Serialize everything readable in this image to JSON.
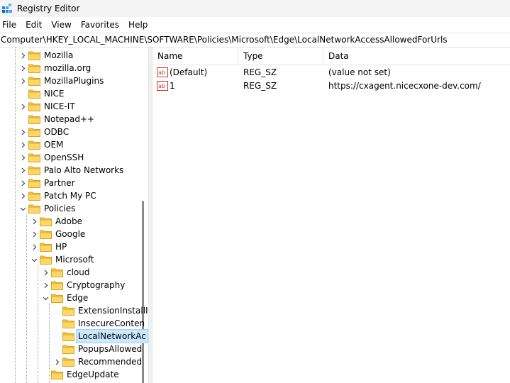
{
  "window": {
    "title": "Registry Editor"
  },
  "menu": [
    "File",
    "Edit",
    "View",
    "Favorites",
    "Help"
  ],
  "address": "Computer\\HKEY_LOCAL_MACHINE\\SOFTWARE\\Policies\\Microsoft\\Edge\\LocalNetworkAccessAllowedForUrls",
  "tree": [
    {
      "label": "Mozilla",
      "level": 0,
      "chevron": "right"
    },
    {
      "label": "mozilla.org",
      "level": 0,
      "chevron": "right"
    },
    {
      "label": "MozillaPlugins",
      "level": 0,
      "chevron": "right"
    },
    {
      "label": "NICE",
      "level": 0,
      "chevron": "none"
    },
    {
      "label": "NICE-IT",
      "level": 0,
      "chevron": "right"
    },
    {
      "label": "Notepad++",
      "level": 0,
      "chevron": "none"
    },
    {
      "label": "ODBC",
      "level": 0,
      "chevron": "right"
    },
    {
      "label": "OEM",
      "level": 0,
      "chevron": "right"
    },
    {
      "label": "OpenSSH",
      "level": 0,
      "chevron": "right"
    },
    {
      "label": "Palo Alto Networks",
      "level": 0,
      "chevron": "right"
    },
    {
      "label": "Partner",
      "level": 0,
      "chevron": "right"
    },
    {
      "label": "Patch My PC",
      "level": 0,
      "chevron": "right"
    },
    {
      "label": "Policies",
      "level": 0,
      "chevron": "down"
    },
    {
      "label": "Adobe",
      "level": 1,
      "chevron": "right"
    },
    {
      "label": "Google",
      "level": 1,
      "chevron": "right"
    },
    {
      "label": "HP",
      "level": 1,
      "chevron": "right"
    },
    {
      "label": "Microsoft",
      "level": 1,
      "chevron": "down"
    },
    {
      "label": "cloud",
      "level": 2,
      "chevron": "right"
    },
    {
      "label": "Cryptography",
      "level": 2,
      "chevron": "right"
    },
    {
      "label": "Edge",
      "level": 2,
      "chevron": "down"
    },
    {
      "label": "ExtensionInstallI",
      "level": 3,
      "chevron": "none"
    },
    {
      "label": "InsecureConten",
      "level": 3,
      "chevron": "none"
    },
    {
      "label": "LocalNetworkAc",
      "level": 3,
      "chevron": "none",
      "selected": true
    },
    {
      "label": "PopupsAllowed",
      "level": 3,
      "chevron": "none"
    },
    {
      "label": "Recommended",
      "level": 3,
      "chevron": "right"
    },
    {
      "label": "EdgeUpdate",
      "level": 2,
      "chevron": "none"
    }
  ],
  "columns": [
    "Name",
    "Type",
    "Data"
  ],
  "values": [
    {
      "name": "(Default)",
      "type": "REG_SZ",
      "data": "(value not set)",
      "icon": "string-value-icon"
    },
    {
      "name": "1",
      "type": "REG_SZ",
      "data": "https://cxagent.nicecxone-dev.com/",
      "icon": "string-value-icon"
    }
  ],
  "colors": {
    "selection_bg": "#cce8ff",
    "selection_border": "#99d1ff",
    "folder": "#f4c542",
    "titlebar": "#f3f3f3"
  }
}
